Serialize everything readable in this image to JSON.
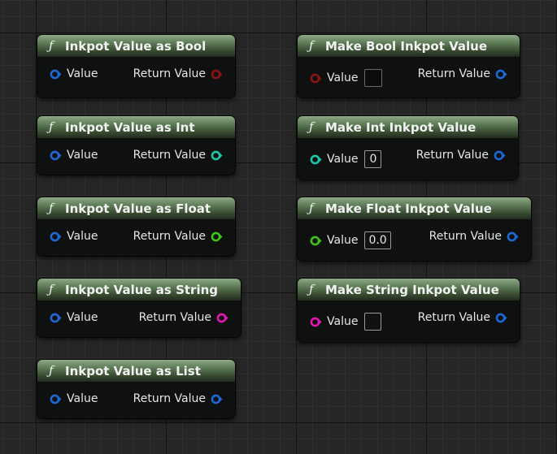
{
  "colors": {
    "struct_pin": "#1d69d6",
    "bool_pin": "#8a1414",
    "int_pin": "#1ac8a6",
    "float_pin": "#3fc41a",
    "string_pin": "#e616b4",
    "node_header": "#4f6b49",
    "graph_background": "#262626"
  },
  "icons": {
    "function": "function-f-icon",
    "pin": "pin-circle-arrow-icon"
  },
  "nodes": [
    {
      "title": "Inkpot Value as Bool",
      "icon": "ƒ",
      "input": {
        "label": "Value",
        "type": "struct"
      },
      "output": {
        "label": "Return Value",
        "type": "bool"
      }
    },
    {
      "title": "Inkpot Value as Int",
      "icon": "ƒ",
      "input": {
        "label": "Value",
        "type": "struct"
      },
      "output": {
        "label": "Return Value",
        "type": "int"
      }
    },
    {
      "title": "Inkpot Value as Float",
      "icon": "ƒ",
      "input": {
        "label": "Value",
        "type": "struct"
      },
      "output": {
        "label": "Return Value",
        "type": "float"
      }
    },
    {
      "title": "Inkpot Value as String",
      "icon": "ƒ",
      "input": {
        "label": "Value",
        "type": "struct"
      },
      "output": {
        "label": "Return Value",
        "type": "string"
      }
    },
    {
      "title": "Inkpot Value as List",
      "icon": "ƒ",
      "input": {
        "label": "Value",
        "type": "struct"
      },
      "output": {
        "label": "Return Value",
        "type": "struct"
      }
    },
    {
      "title": "Make Bool Inkpot Value",
      "icon": "ƒ",
      "input": {
        "label": "Value",
        "type": "bool",
        "default": "",
        "checked": false
      },
      "output": {
        "label": "Return Value",
        "type": "struct"
      }
    },
    {
      "title": "Make Int Inkpot Value",
      "icon": "ƒ",
      "input": {
        "label": "Value",
        "type": "int",
        "default": "0"
      },
      "output": {
        "label": "Return Value",
        "type": "struct"
      }
    },
    {
      "title": "Make Float Inkpot Value",
      "icon": "ƒ",
      "input": {
        "label": "Value",
        "type": "float",
        "default": "0.0"
      },
      "output": {
        "label": "Return Value",
        "type": "struct"
      }
    },
    {
      "title": "Make String Inkpot Value",
      "icon": "ƒ",
      "input": {
        "label": "Value",
        "type": "string",
        "default": ""
      },
      "output": {
        "label": "Return Value",
        "type": "struct"
      }
    }
  ]
}
